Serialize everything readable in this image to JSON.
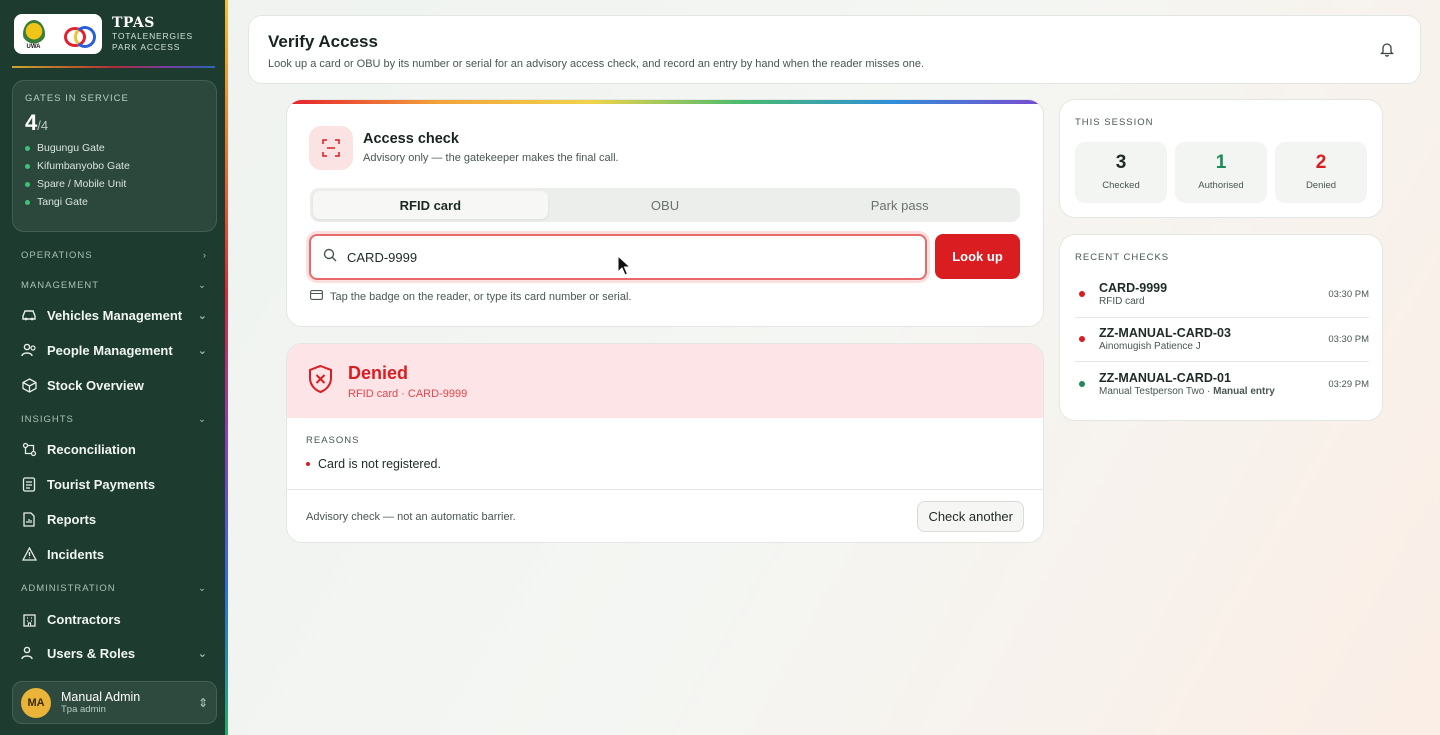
{
  "brand": {
    "name": "TPAS",
    "line1": "TOTALENERGIES",
    "line2": "PARK ACCESS",
    "uwa": "UWA"
  },
  "gates": {
    "title": "GATES IN SERVICE",
    "active": "4",
    "total": "/4",
    "items": [
      "Bugungu Gate",
      "Kifumbanyobo Gate",
      "Spare / Mobile Unit",
      "Tangi Gate"
    ]
  },
  "nav": {
    "operations": "OPERATIONS",
    "management": "MANAGEMENT",
    "vehicles": "Vehicles Management",
    "people": "People Management",
    "stock": "Stock Overview",
    "insights": "INSIGHTS",
    "reconciliation": "Reconciliation",
    "tourist": "Tourist Payments",
    "reports": "Reports",
    "incidents": "Incidents",
    "administration": "ADMINISTRATION",
    "contractors": "Contractors",
    "users": "Users & Roles"
  },
  "user": {
    "initials": "MA",
    "name": "Manual Admin",
    "role": "Tpa admin"
  },
  "header": {
    "title": "Verify Access",
    "subtitle": "Look up a card or OBU by its number or serial for an advisory access check, and record an entry by hand when the reader misses one."
  },
  "access": {
    "title": "Access check",
    "subtitle": "Advisory only — the gatekeeper makes the final call.",
    "tabs": [
      "RFID card",
      "OBU",
      "Park pass"
    ],
    "search_value": "CARD-9999",
    "lookup": "Look up",
    "hint": "Tap the badge on the reader, or type its card number or serial."
  },
  "result": {
    "status": "Denied",
    "detail": "RFID card · CARD-9999",
    "reasons_label": "REASONS",
    "reason": "Card is not registered.",
    "footer": "Advisory check — not an automatic barrier.",
    "check_another": "Check another"
  },
  "session": {
    "label": "THIS SESSION",
    "checked": "3",
    "checked_label": "Checked",
    "authorised": "1",
    "authorised_label": "Authorised",
    "denied": "2",
    "denied_label": "Denied"
  },
  "recent": {
    "label": "RECENT CHECKS",
    "items": [
      {
        "id": "CARD-9999",
        "sub": "RFID card",
        "sub_bold": "",
        "time": "03:30 PM",
        "status": "denied"
      },
      {
        "id": "ZZ-MANUAL-CARD-03",
        "sub": "Ainomugish Patience J",
        "sub_bold": "",
        "time": "03:30 PM",
        "status": "denied"
      },
      {
        "id": "ZZ-MANUAL-CARD-01",
        "sub": "Manual Testperson Two · ",
        "sub_bold": "Manual entry",
        "time": "03:29 PM",
        "status": "authorised"
      }
    ]
  },
  "colors": {
    "sidebar": "#1d3b2f",
    "denied": "#d91d21",
    "authorised": "#1f8a5a",
    "accent_gold": "#e9b437"
  }
}
